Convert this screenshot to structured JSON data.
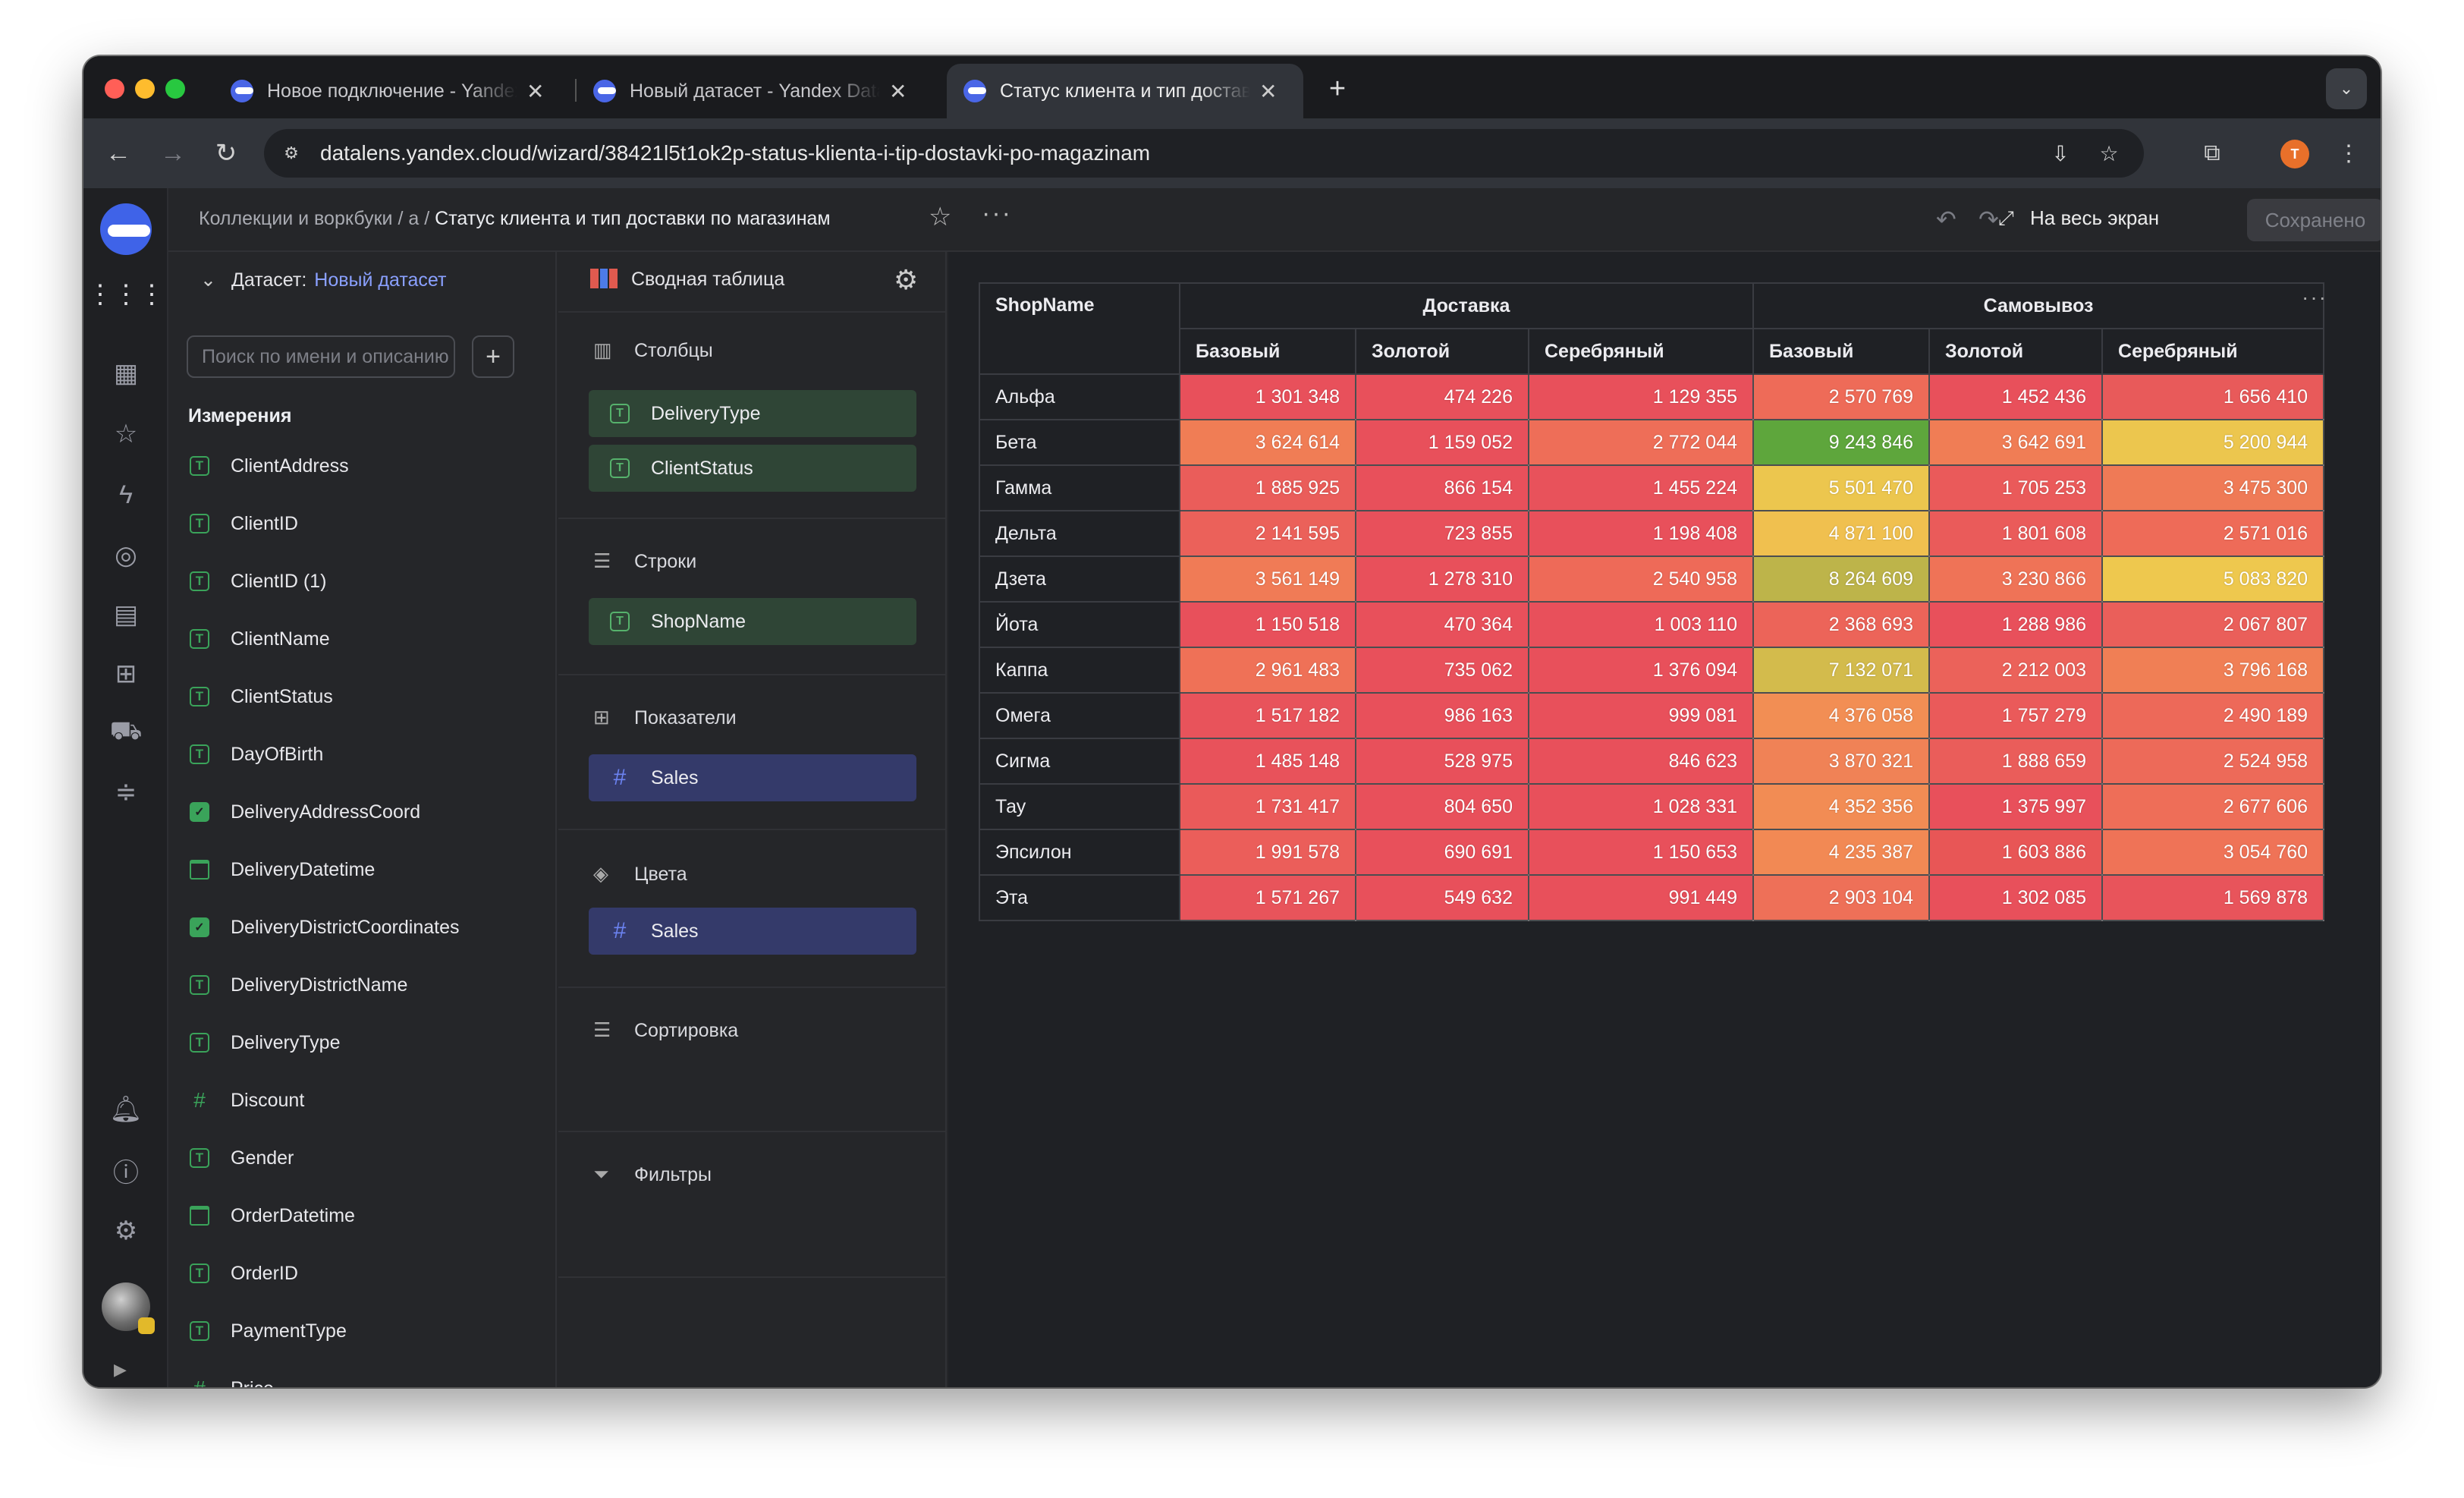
{
  "browser": {
    "tabs": [
      {
        "title": "Новое подключение - Yandex DataLens"
      },
      {
        "title": "Новый датасет - Yandex DataLens"
      },
      {
        "title": "Статус клиента и тип доставки по магазинам"
      }
    ],
    "url": "datalens.yandex.cloud/wizard/38421l5t1ok2p-status-klienta-i-tip-dostavki-po-magazinam",
    "profile_initial": "T",
    "colors": {
      "close": "#ff5f57",
      "minimize": "#febc2e",
      "zoom": "#28c840",
      "profile": "#e8702a"
    }
  },
  "topbar": {
    "breadcrumb_root": "Коллекции и воркбуки",
    "breadcrumb_folder": "а",
    "breadcrumb_current": "Статус клиента и тип доставки по магазинам",
    "fullscreen_label": "На весь экран",
    "saved_label": "Сохранено"
  },
  "dataset": {
    "label": "Датасет:",
    "name": "Новый датасет",
    "search_placeholder": "Поиск по имени и описанию",
    "dimensions_title": "Измерения",
    "fields": [
      {
        "name": "ClientAddress",
        "type": "text"
      },
      {
        "name": "ClientID",
        "type": "text"
      },
      {
        "name": "ClientID (1)",
        "type": "text"
      },
      {
        "name": "ClientName",
        "type": "text"
      },
      {
        "name": "ClientStatus",
        "type": "text"
      },
      {
        "name": "DayOfBirth",
        "type": "text"
      },
      {
        "name": "DeliveryAddressCoord",
        "type": "geo"
      },
      {
        "name": "DeliveryDatetime",
        "type": "date"
      },
      {
        "name": "DeliveryDistrictCoordinates",
        "type": "geo"
      },
      {
        "name": "DeliveryDistrictName",
        "type": "text"
      },
      {
        "name": "DeliveryType",
        "type": "text"
      },
      {
        "name": "Discount",
        "type": "number"
      },
      {
        "name": "Gender",
        "type": "text"
      },
      {
        "name": "OrderDatetime",
        "type": "date"
      },
      {
        "name": "OrderID",
        "type": "text"
      },
      {
        "name": "PaymentType",
        "type": "text"
      },
      {
        "name": "Price",
        "type": "number"
      }
    ]
  },
  "config": {
    "viz_type": "Сводная таблица",
    "columns_title": "Столбцы",
    "columns": [
      "DeliveryType",
      "ClientStatus"
    ],
    "rows_title": "Строки",
    "rows": [
      "ShopName"
    ],
    "measures_title": "Показатели",
    "measures": [
      "Sales"
    ],
    "colors_title": "Цвета",
    "colors": [
      "Sales"
    ],
    "sort_title": "Сортировка",
    "filters_title": "Фильтры"
  },
  "pivot": {
    "row_header": "ShopName",
    "groups": [
      "Доставка",
      "Самовывоз"
    ],
    "subcolumns": [
      "Базовый",
      "Золотой",
      "Серебряный"
    ],
    "rows": [
      {
        "shop": "Альфа",
        "values": [
          "1 301 348",
          "474 226",
          "1 129 355",
          "2 570 769",
          "1 452 436",
          "1 656 410"
        ],
        "colors": [
          "#e8505b",
          "#e8505b",
          "#e8505b",
          "#ee6b58",
          "#e8505b",
          "#e85a5a"
        ]
      },
      {
        "shop": "Бета",
        "values": [
          "3 624 614",
          "1 159 052",
          "2 772 044",
          "9 243 846",
          "3 642 691",
          "5 200 944"
        ],
        "colors": [
          "#f07d55",
          "#e8505b",
          "#ee6e58",
          "#5ea63c",
          "#f07d55",
          "#ecc64e"
        ]
      },
      {
        "shop": "Гамма",
        "values": [
          "1 885 925",
          "866 154",
          "1 455 224",
          "5 501 470",
          "1 705 253",
          "3 475 300"
        ],
        "colors": [
          "#ea5d5a",
          "#e8505b",
          "#e8525b",
          "#ecc64e",
          "#ea5a5a",
          "#ef7a56"
        ]
      },
      {
        "shop": "Дельта",
        "values": [
          "2 141 595",
          "723 855",
          "1 198 408",
          "4 871 100",
          "1 801 608",
          "2 571 016"
        ],
        "colors": [
          "#eb615a",
          "#e8505b",
          "#e8505b",
          "#f0c04f",
          "#ea5b5a",
          "#ee6b58"
        ]
      },
      {
        "shop": "Дзета",
        "values": [
          "3 561 149",
          "1 278 310",
          "2 540 958",
          "8 264 609",
          "3 230 866",
          "5 083 820"
        ],
        "colors": [
          "#f07b56",
          "#e8505b",
          "#ee6a58",
          "#bdb44a",
          "#ef7357",
          "#eec84e"
        ]
      },
      {
        "shop": "Йота",
        "values": [
          "1 150 518",
          "470 364",
          "1 003 110",
          "2 368 693",
          "1 288 986",
          "2 067 807"
        ],
        "colors": [
          "#e8505b",
          "#e8505b",
          "#e8505b",
          "#ec6459",
          "#e8505b",
          "#ea5f5a"
        ]
      },
      {
        "shop": "Каппа",
        "values": [
          "2 961 483",
          "735 062",
          "1 376 094",
          "7 132 071",
          "2 212 003",
          "3 796 168"
        ],
        "colors": [
          "#ef7157",
          "#e8505b",
          "#e8505b",
          "#d3bb4c",
          "#eb625a",
          "#f07f55"
        ]
      },
      {
        "shop": "Омега",
        "values": [
          "1 517 182",
          "986 163",
          "999 081",
          "4 376 058",
          "1 757 279",
          "2 490 189"
        ],
        "colors": [
          "#e8535b",
          "#e8505b",
          "#e8505b",
          "#f28e54",
          "#ea5a5a",
          "#ed6959"
        ]
      },
      {
        "shop": "Сигма",
        "values": [
          "1 485 148",
          "528 975",
          "846 623",
          "3 870 321",
          "1 888 659",
          "2 524 958"
        ],
        "colors": [
          "#e8525b",
          "#e8505b",
          "#e8505b",
          "#f08256",
          "#ea5d5a",
          "#ed6a59"
        ]
      },
      {
        "shop": "Тау",
        "values": [
          "1 731 417",
          "804 650",
          "1 028 331",
          "4 352 356",
          "1 375 997",
          "2 677 606"
        ],
        "colors": [
          "#ea5a5a",
          "#e8505b",
          "#e8505b",
          "#f28c54",
          "#e8505b",
          "#ee6e58"
        ]
      },
      {
        "shop": "Эпсилон",
        "values": [
          "1 991 578",
          "690 691",
          "1 150 653",
          "4 235 387",
          "1 603 886",
          "3 054 760"
        ],
        "colors": [
          "#eb5e5a",
          "#e8505b",
          "#e8505b",
          "#f28954",
          "#e85656",
          "#ef7357"
        ]
      },
      {
        "shop": "Эта",
        "values": [
          "1 571 267",
          "549 632",
          "991 449",
          "2 903 104",
          "1 302 085",
          "1 569 878"
        ],
        "colors": [
          "#e8545b",
          "#e8505b",
          "#e8505b",
          "#ee7058",
          "#e8505b",
          "#e8545b"
        ]
      }
    ]
  }
}
